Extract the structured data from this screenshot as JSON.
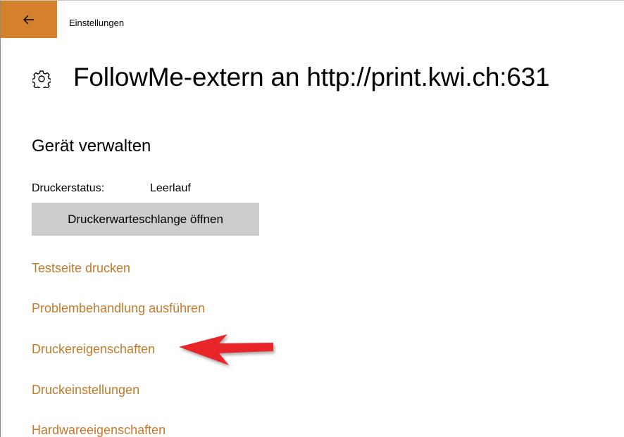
{
  "window": {
    "title": "Einstellungen",
    "back_icon": "back-arrow-icon",
    "accent_color": "#d5812b"
  },
  "header": {
    "icon": "gear-icon",
    "title": "FollowMe-extern an http://print.kwi.ch:631"
  },
  "manage": {
    "section_title": "Gerät verwalten",
    "status_label": "Druckerstatus:",
    "status_value": "Leerlauf",
    "queue_button": "Druckerwarteschlange öffnen",
    "links": [
      {
        "label": "Testseite drucken"
      },
      {
        "label": "Problembehandlung ausführen"
      },
      {
        "label": "Druckereigenschaften"
      },
      {
        "label": "Druckeinstellungen"
      },
      {
        "label": "Hardwareeigenschaften"
      }
    ],
    "link_color": "#c47a2c"
  },
  "annotation": {
    "icon": "red-arrow-icon",
    "color": "#e8262a",
    "points_to": "Druckereigenschaften"
  }
}
